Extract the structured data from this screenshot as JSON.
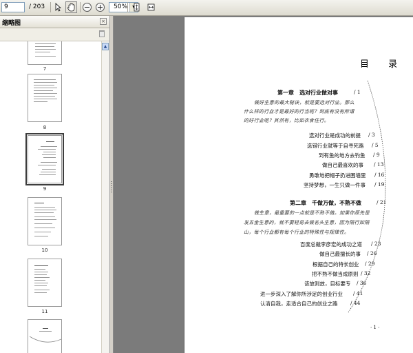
{
  "toolbar": {
    "page_current": "9",
    "page_total": "/ 203",
    "zoom_value": "50%",
    "icons": [
      "select-arrow-icon",
      "hand-tool-icon",
      "zoom-out-icon",
      "zoom-in-icon",
      "fit-page-icon",
      "fit-width-icon"
    ]
  },
  "sidebar": {
    "title": "缩略图",
    "thumbnails": [
      {
        "label": "7"
      },
      {
        "label": "8"
      },
      {
        "label": "9",
        "selected": true
      },
      {
        "label": "10"
      },
      {
        "label": "11"
      },
      {
        "label": ""
      }
    ]
  },
  "document": {
    "toc_title": "目 录",
    "chapter1": {
      "title": "第一章　选对行业做对事",
      "page": "/ 1"
    },
    "chapter1_intro": [
      "做好生意的最大秘诀，就是要选对行业。那么",
      "什么样的行业才是最好的行当呢？到底有没有所谓",
      "的好行业呢？其然有，比如衣食住行。"
    ],
    "chapter1_items": [
      {
        "text": "选对行业是成功的前提",
        "page": "/ 3"
      },
      {
        "text": "选错行业就等于自寻死路",
        "page": "/ 5"
      },
      {
        "text": "到有鱼的地方去钓鱼",
        "page": "/ 9"
      },
      {
        "text": "做自己最喜欢的事",
        "page": "/ 13"
      },
      {
        "text": "勇敢地把帽子扔进围墙里",
        "page": "/ 16"
      },
      {
        "text": "坚持梦想，一生只做一件事",
        "page": "/ 19"
      }
    ],
    "chapter2": {
      "title": "第二章　千做万做，不熟不做",
      "page": "/ 21"
    },
    "chapter2_intro": [
      "做生意，最重要的一点就是不熟不做。如果你原先是",
      "发五金生意的，就不要轻易去做名头生意，因为隔行如隔",
      "山，每个行业都有每个行业的特殊性与规律性。"
    ],
    "chapter2_items": [
      {
        "text": "百度总裁李彦宏的成功之道",
        "page": "/ 23"
      },
      {
        "text": "做自己最擅长的事",
        "page": "/ 26"
      },
      {
        "text": "根据自己的特长创业",
        "page": "/ 29"
      },
      {
        "text": "把不熟不做当成原则",
        "page": "/ 32"
      },
      {
        "text": "该放则放，目标要专",
        "page": "/ 36"
      },
      {
        "text": "进一步深入了解你所涉足的创业行业",
        "page": "/ 41"
      },
      {
        "text": "认清自我，走适合自己的创业之路",
        "page": "/ 44"
      }
    ],
    "page_number": "· 1 ·"
  }
}
